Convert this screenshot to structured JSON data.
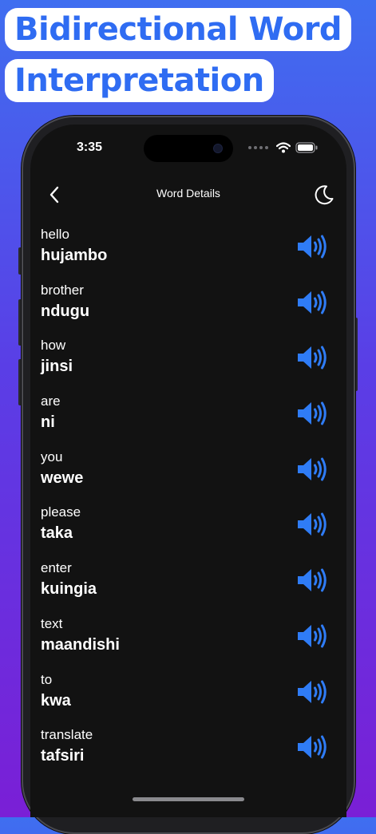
{
  "promo": {
    "line1": "Bidirectional Word",
    "line2": "Interpretation"
  },
  "status_bar": {
    "time": "3:35"
  },
  "nav": {
    "title": "Word Details",
    "back_icon": "chevron-left-icon",
    "theme_icon": "moon-icon"
  },
  "colors": {
    "accent": "#2f7cf6",
    "screen_bg": "#121212",
    "text": "#ffffff"
  },
  "words": [
    {
      "source": "hello",
      "target": "hujambo"
    },
    {
      "source": "brother",
      "target": "ndugu"
    },
    {
      "source": "how",
      "target": "jinsi"
    },
    {
      "source": "are",
      "target": "ni"
    },
    {
      "source": "you",
      "target": "wewe"
    },
    {
      "source": "please",
      "target": "taka"
    },
    {
      "source": "enter",
      "target": "kuingia"
    },
    {
      "source": "text",
      "target": "maandishi"
    },
    {
      "source": "to",
      "target": "kwa"
    },
    {
      "source": "translate",
      "target": "tafsiri"
    }
  ]
}
